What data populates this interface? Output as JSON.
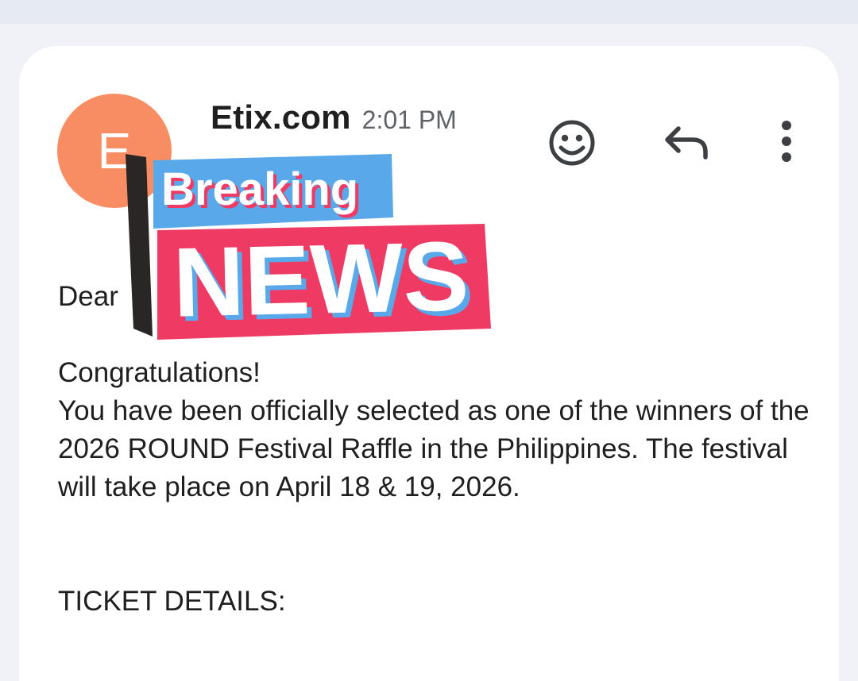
{
  "email": {
    "avatar_letter": "E",
    "sender": "Etix.com",
    "time": "2:01 PM",
    "body": {
      "greeting": "Dear",
      "congrats": "Congratulations!",
      "paragraph": "You have been officially selected as one of the winners of the 2026 ROUND Festival Raffle in the Philippines. The festival will take place on April 18 & 19, 2026.",
      "ticket_heading": "TICKET DETAILS:"
    },
    "actions": {
      "react_icon": "smiley-face-icon",
      "reply_icon": "reply-arrow-icon",
      "more_icon": "more-vertical-icon"
    }
  },
  "overlay": {
    "line1": "Breaking",
    "line2": "NEWS"
  },
  "colors": {
    "avatar": "#f88c62",
    "sticker_blue": "#59a8ea",
    "sticker_pink": "#ef3b63",
    "sticker_bar": "#2a2626"
  }
}
